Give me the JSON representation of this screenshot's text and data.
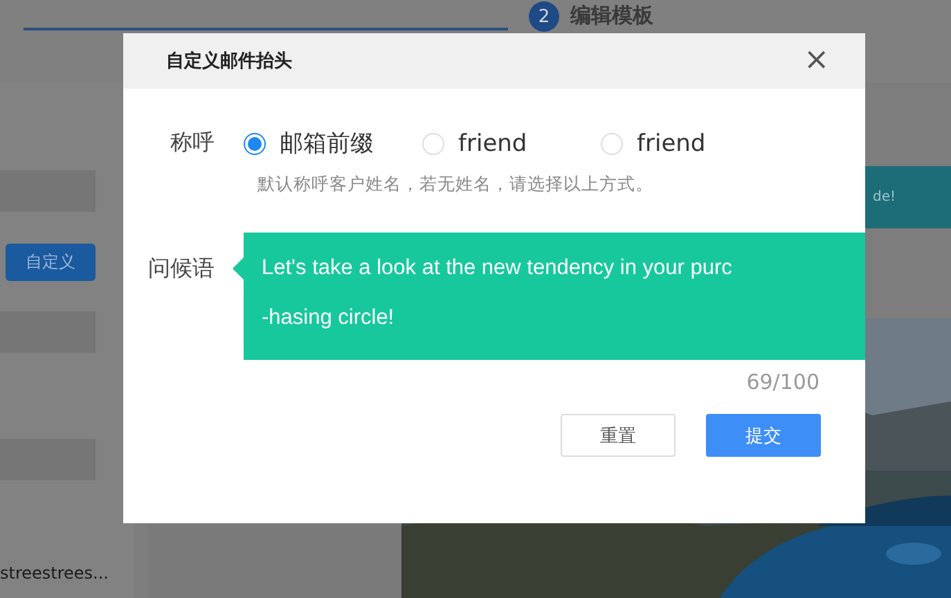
{
  "background": {
    "step": {
      "number": "2",
      "label": "编辑模板"
    },
    "custom_button": "自定义",
    "item_text": "streestrees...",
    "banner_text": "de!"
  },
  "dialog": {
    "title": "自定义邮件抬头",
    "close": "×",
    "salutation": {
      "label": "称呼",
      "options": [
        {
          "label": "邮箱前缀",
          "selected": true
        },
        {
          "label": "friend",
          "selected": false
        },
        {
          "label": "friend",
          "selected": false
        }
      ],
      "hint": "默认称呼客户姓名，若无姓名，请选择以上方式。"
    },
    "greeting": {
      "label": "问候语",
      "lines": [
        "Let's take a look at the new tendency in your purc",
        "-hasing circle!"
      ],
      "counter": "69/100"
    },
    "buttons": [
      {
        "label": "重置",
        "kind": "secondary"
      },
      {
        "label": "提交",
        "kind": "primary"
      }
    ]
  }
}
